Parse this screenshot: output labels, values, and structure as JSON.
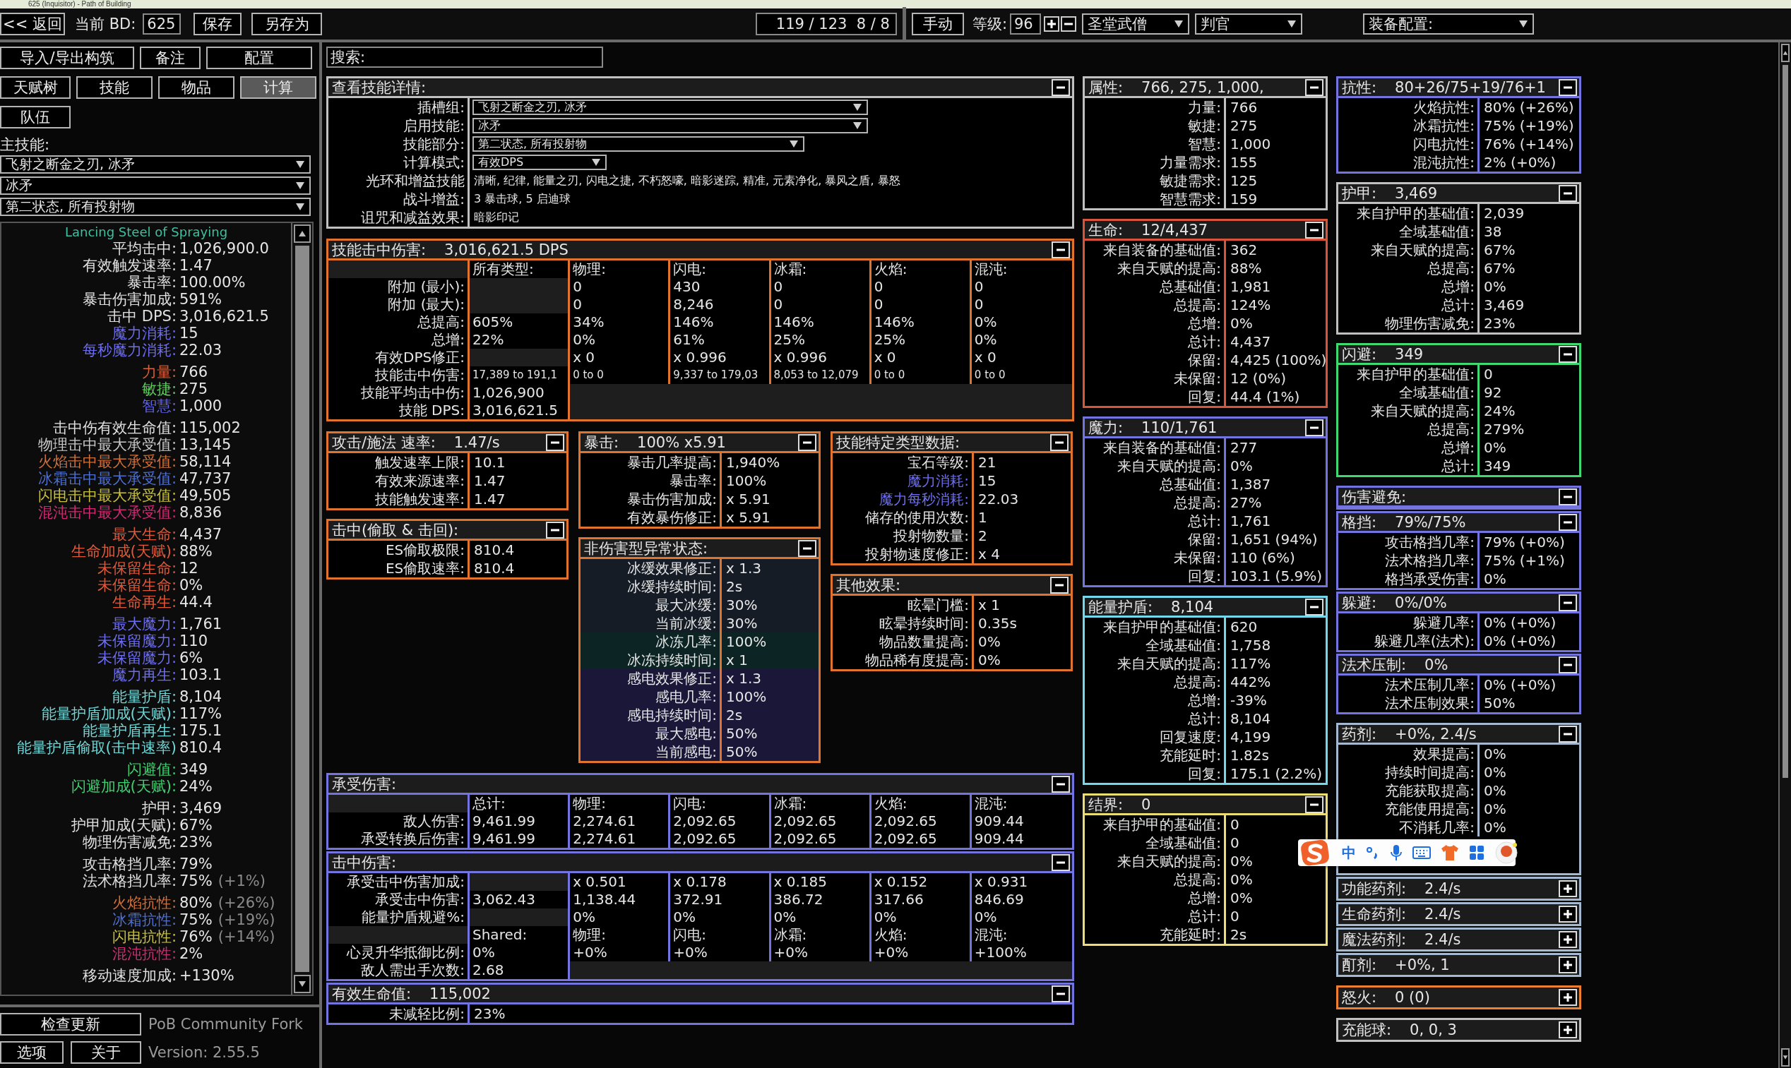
{
  "window": {
    "title": "625 (Inquisitor) - Path of Building"
  },
  "top_bar": {
    "back": "<< 返回",
    "build_label": "当前 BD:",
    "build_name": "625",
    "save": "保存",
    "save_as": "另存为",
    "points": "119 / 123  8 / 8",
    "mode": "手动",
    "level_label": "等级:",
    "level": "96",
    "class": "圣堂武僧",
    "ascendancy": "判官",
    "item_set": "装备配置:"
  },
  "left_panel": {
    "buttons": [
      {
        "label": "导入/导出构筑"
      },
      {
        "label": "备注"
      },
      {
        "label": "配置"
      }
    ],
    "tabs": [
      {
        "label": "天赋树",
        "selected": false
      },
      {
        "label": "技能",
        "selected": false
      },
      {
        "label": "物品",
        "selected": false
      },
      {
        "label": "计算",
        "selected": true
      },
      {
        "label": "队伍",
        "selected": false
      }
    ],
    "main_skill_label": "主技能:",
    "skill_selects": [
      "飞射之断金之刃, 冰矛",
      "冰矛",
      "第二状态, 所有投射物"
    ],
    "skill_name": "Lancing Steel of Spraying",
    "stat_groups": [
      [
        {
          "label": "平均击中:",
          "value": "1,026,900.0",
          "color": "#e0e0e0"
        },
        {
          "label": "有效触发速率:",
          "value": "1.47",
          "color": "#e0e0e0"
        },
        {
          "label": "暴击率:",
          "value": "100.00%",
          "color": "#e0e0e0"
        },
        {
          "label": "暴击伤害加成:",
          "value": "591%",
          "color": "#e0e0e0"
        },
        {
          "label": "击中 DPS:",
          "value": "3,016,621.5",
          "color": "#e0e0e0"
        },
        {
          "label": "魔力消耗:",
          "value": "15",
          "color": "#6e6ef0"
        },
        {
          "label": "每秒魔力消耗:",
          "value": "22.03",
          "color": "#6e6ef0"
        }
      ],
      [
        {
          "label": "力量:",
          "value": "766",
          "color": "#d8603a"
        },
        {
          "label": "敏捷:",
          "value": "275",
          "color": "#60d060"
        },
        {
          "label": "智慧:",
          "value": "1,000",
          "color": "#6262e8"
        }
      ],
      [
        {
          "label": "击中伤有效生命值:",
          "value": "115,002",
          "color": "#e0e0e0"
        },
        {
          "label": "物理击中最大承受值:",
          "value": "13,145",
          "color": "#c8c8c8"
        },
        {
          "label": "火焰击中最大承受值:",
          "value": "58,114",
          "color": "#d0703a"
        },
        {
          "label": "冰霜击中最大承受值:",
          "value": "47,737",
          "color": "#5070d0"
        },
        {
          "label": "闪电击中最大承受值:",
          "value": "49,505",
          "color": "#c8c040"
        },
        {
          "label": "混沌击中最大承受值:",
          "value": "8,836",
          "color": "#d02c74"
        }
      ],
      [
        {
          "label": "最大生命:",
          "value": "4,437",
          "color": "#e05a3a"
        },
        {
          "label": "生命加成(天赋):",
          "value": "88%",
          "color": "#e05a3a"
        },
        {
          "label": "未保留生命:",
          "value": "12",
          "color": "#e05a3a"
        },
        {
          "label": "未保留生命:",
          "value": "0%",
          "color": "#e05a3a"
        },
        {
          "label": "生命再生:",
          "value": "44.4",
          "color": "#e05a3a"
        }
      ],
      [
        {
          "label": "最大魔力:",
          "value": "1,761",
          "color": "#6e6ef0"
        },
        {
          "label": "未保留魔力:",
          "value": "110",
          "color": "#6e6ef0"
        },
        {
          "label": "未保留魔力:",
          "value": "6%",
          "color": "#6e6ef0"
        },
        {
          "label": "魔力再生:",
          "value": "103.1",
          "color": "#6e6ef0"
        }
      ],
      [
        {
          "label": "能量护盾:",
          "value": "8,104",
          "color": "#70d8d8"
        },
        {
          "label": "能量护盾加成(天赋):",
          "value": "117%",
          "color": "#70d8d8"
        },
        {
          "label": "能量护盾再生:",
          "value": "175.1",
          "color": "#70d8d8"
        },
        {
          "label": "能量护盾偷取(击中速率)",
          "value": "810.4",
          "color": "#70d8d8"
        }
      ],
      [
        {
          "label": "闪避值:",
          "value": "349",
          "color": "#40d070"
        },
        {
          "label": "闪避加成(天赋):",
          "value": "24%",
          "color": "#40d070"
        }
      ],
      [
        {
          "label": "护甲:",
          "value": "3,469",
          "color": "#e0e0e0"
        },
        {
          "label": "护甲加成(天赋):",
          "value": "67%",
          "color": "#e0e0e0"
        },
        {
          "label": "物理伤害减免:",
          "value": "23%",
          "color": "#e0e0e0"
        }
      ],
      [
        {
          "label": "攻击格挡几率:",
          "value": "79%",
          "color": "#e0e0e0"
        },
        {
          "label": "法术格挡几率:",
          "value": "75%",
          "extra": "(+1%)",
          "color": "#e0e0e0"
        }
      ],
      [
        {
          "label": "火焰抗性:",
          "value": "80%",
          "extra": "(+26%)",
          "color": "#d0703a"
        },
        {
          "label": "冰霜抗性:",
          "value": "75%",
          "extra": "(+19%)",
          "color": "#5070d0"
        },
        {
          "label": "闪电抗性:",
          "value": "76%",
          "extra": "(+14%)",
          "color": "#c8c040"
        },
        {
          "label": "混沌抗性:",
          "value": "2%",
          "color": "#d02c74"
        }
      ],
      [
        {
          "label": "移动速度加成:",
          "value": "+130%",
          "color": "#e0e0e0"
        }
      ]
    ],
    "footer": {
      "check_update": "检查更新",
      "fork": "PoB Community Fork",
      "options": "选项",
      "about": "关于",
      "version": "Version: 2.55.5"
    }
  },
  "search": {
    "label": "搜索:"
  },
  "column_a": {
    "top": [
      {
        "title": "查看技能详情:",
        "color": "#c0c0c0",
        "expanded": true,
        "kind": "fields",
        "rows": [
          {
            "label": "插槽组:",
            "value": "飞射之断金之刃, 冰矛",
            "kind": "select"
          },
          {
            "label": "启用技能:",
            "value": "冰矛",
            "kind": "select"
          },
          {
            "label": "技能部分:",
            "value": "第二状态, 所有投射物",
            "kind": "select"
          },
          {
            "label": "计算模式:",
            "value": "有效DPS",
            "kind": "select"
          },
          {
            "label": "光环和增益技能",
            "value": "清晰, 纪律, 能量之刃, 闪电之捷, 不朽怒嚎, 暗影迷踪, 精准, 元素净化, 暴风之盾, 暴怒",
            "kind": "text"
          },
          {
            "label": "战斗增益:",
            "value": "3 暴击球, 5 启迪球",
            "kind": "text"
          },
          {
            "label": "诅咒和减益效果:",
            "value": "暗影印记",
            "kind": "text"
          }
        ]
      },
      {
        "title": "技能击中伤害:",
        "value": "3,016,621.5 DPS",
        "color": "#e0742e",
        "expanded": true,
        "kind": "table",
        "columns": [
          "所有类型:",
          "物理:",
          "闪电:",
          "冰霜:",
          "火焰:",
          "混沌:"
        ],
        "rows": [
          {
            "label": "附加 (最小):",
            "cells": [
              null,
              "0",
              "430",
              "0",
              "0",
              "0"
            ]
          },
          {
            "label": "附加 (最大):",
            "cells": [
              null,
              "0",
              "8,246",
              "0",
              "0",
              "0"
            ]
          },
          {
            "label": "总提高:",
            "cells": [
              "605%",
              "34%",
              "146%",
              "146%",
              "146%",
              "0%"
            ]
          },
          {
            "label": "总增:",
            "cells": [
              "22%",
              "0%",
              "61%",
              "25%",
              "25%",
              "0%"
            ]
          },
          {
            "label": "有效DPS修正:",
            "cells": [
              null,
              "x 0",
              "x 0.996",
              "x 0.996",
              "x 0",
              "x 0"
            ]
          },
          {
            "label": "技能击中伤害:",
            "kind": "small",
            "cells": [
              "17,389 to 191,1",
              "0 to 0",
              "9,337 to 179,03",
              "8,053 to 12,079",
              "0 to 0",
              "0 to 0"
            ]
          },
          {
            "label": "技能平均击中伤:",
            "cells": [
              "1,026,900"
            ]
          },
          {
            "label": "技能 DPS:",
            "cells": [
              "3,016,621.5"
            ]
          }
        ]
      }
    ],
    "mini_columns": [
      [
        {
          "title": "攻击/施法 速率:",
          "value": "1.47/s",
          "color": "#e0742e",
          "expanded": true,
          "kind": "rows",
          "rows": [
            {
              "label": "触发速率上限:",
              "value": "10.1"
            },
            {
              "label": "有效来源速率:",
              "value": "1.47"
            },
            {
              "label": "技能触发速率:",
              "value": "1.47"
            }
          ]
        },
        {
          "title": "击中(偷取 & 击回):",
          "color": "#e0742e",
          "expanded": true,
          "kind": "rows",
          "rows": [
            {
              "label": "ES偷取极限:",
              "value": "810.4"
            },
            {
              "label": "ES偷取速率:",
              "value": "810.4"
            }
          ]
        }
      ],
      [
        {
          "title": "暴击:",
          "value": "100% x5.91",
          "color": "#e0742e",
          "expanded": true,
          "kind": "rows",
          "rows": [
            {
              "label": "暴击几率提高:",
              "value": "1,940%"
            },
            {
              "label": "暴击率:",
              "value": "100%"
            },
            {
              "label": "暴击伤害加成:",
              "value": "x 5.91"
            },
            {
              "label": "有效暴伤修正:",
              "value": "x 5.91"
            }
          ]
        },
        {
          "title": "非伤害型异常状态:",
          "color": "#e0742e",
          "expanded": true,
          "kind": "rows",
          "rows": [
            {
              "label": "冰缓效果修正:",
              "value": "x 1.3",
              "kind": "chill"
            },
            {
              "label": "冰缓持续时间:",
              "value": "2s",
              "kind": "chill"
            },
            {
              "label": "最大冰缓:",
              "value": "30%",
              "kind": "chill"
            },
            {
              "label": "当前冰缓:",
              "value": "30%",
              "kind": "chill"
            },
            {
              "label": "冰冻几率:",
              "value": "100%",
              "kind": "freeze"
            },
            {
              "label": "冰冻持续时间:",
              "value": "x 1",
              "kind": "freeze"
            },
            {
              "label": "感电效果修正:",
              "value": "x 1.3",
              "kind": "shock"
            },
            {
              "label": "感电几率:",
              "value": "100%",
              "kind": "shock"
            },
            {
              "label": "感电持续时间:",
              "value": "2s",
              "kind": "shock"
            },
            {
              "label": "最大感电:",
              "value": "50%",
              "kind": "shock"
            },
            {
              "label": "当前感电:",
              "value": "50%",
              "kind": "shock"
            }
          ]
        }
      ],
      [
        {
          "title": "技能特定类型数据:",
          "color": "#e0742e",
          "expanded": true,
          "kind": "rows",
          "rows": [
            {
              "label": "宝石等级:",
              "value": "21"
            },
            {
              "label": "魔力消耗:",
              "value": "15",
              "color": "#6e6ef0"
            },
            {
              "label": "魔力每秒消耗:",
              "value": "22.03",
              "color": "#6e6ef0"
            },
            {
              "label": "储存的使用次数:",
              "value": "1"
            },
            {
              "label": "投射物数量:",
              "value": "2"
            },
            {
              "label": "投射物速度修正:",
              "value": "x 4"
            }
          ]
        },
        {
          "title": "其他效果:",
          "color": "#e0742e",
          "expanded": true,
          "kind": "rows",
          "rows": [
            {
              "label": "眩晕门槛:",
              "value": "x 1"
            },
            {
              "label": "眩晕持续时间:",
              "value": "0.35s"
            },
            {
              "label": "物品数量提高:",
              "value": "0%"
            },
            {
              "label": "物品稀有度提高:",
              "value": "0%"
            }
          ]
        }
      ]
    ],
    "bottom": [
      {
        "title": "承受伤害:",
        "color": "#7474e0",
        "expanded": true,
        "kind": "table",
        "columns": [
          "总计:",
          "物理:",
          "闪电:",
          "冰霜:",
          "火焰:",
          "混沌:"
        ],
        "rows": [
          {
            "label": "敌人伤害:",
            "cells": [
              "9,461.99",
              "2,274.61",
              "2,092.65",
              "2,092.65",
              "2,092.65",
              "909.44"
            ]
          },
          {
            "label": "承受转换后伤害:",
            "cells": [
              "9,461.99",
              "2,274.61",
              "2,092.65",
              "2,092.65",
              "2,092.65",
              "909.44"
            ]
          }
        ]
      },
      {
        "title": "击中伤害:",
        "color": "#7474e0",
        "expanded": true,
        "kind": "table",
        "rows": [
          {
            "label": "承受击中伤害加成:",
            "cells": [
              null,
              "x 0.501",
              "x 0.178",
              "x 0.185",
              "x 0.152",
              "x 0.931"
            ]
          },
          {
            "label": "承受击中伤害:",
            "cells": [
              "3,062.43",
              "1,138.44",
              "372.91",
              "386.72",
              "317.66",
              "846.69"
            ]
          },
          {
            "label": "能量护盾规避%:",
            "cells": [
              null,
              "0%",
              "0%",
              "0%",
              "0%",
              "0%"
            ]
          },
          {
            "kind": "header",
            "cells": [
              "Shared:",
              "物理:",
              "闪电:",
              "冰霜:",
              "火焰:",
              "混沌:"
            ]
          },
          {
            "label": "心灵升华抵御比例:",
            "cells": [
              "0%",
              "+0%",
              "+0%",
              "+0%",
              "+0%",
              "+100%"
            ]
          },
          {
            "label": "敌人需出手次数:",
            "cells": [
              "2.68"
            ]
          }
        ]
      },
      {
        "title": "有效生命值:",
        "value": "115,002",
        "color": "#7474e0",
        "expanded": true,
        "kind": "rows",
        "rows": [
          {
            "label": "未减轻比例:",
            "value": "23%"
          }
        ]
      }
    ]
  },
  "column_b": [
    [
      {
        "title": "属性:",
        "value": "766, 275, 1,000,",
        "color": "#c0c0c0",
        "expanded": true,
        "kind": "rows",
        "rows": [
          {
            "label": "力量:",
            "value": "766"
          },
          {
            "label": "敏捷:",
            "value": "275"
          },
          {
            "label": "智慧:",
            "value": "1,000"
          },
          {
            "label": "力量需求:",
            "value": "155"
          },
          {
            "label": "敏捷需求:",
            "value": "125"
          },
          {
            "label": "智慧需求:",
            "value": "159"
          }
        ]
      }
    ],
    [
      {
        "title": "生命:",
        "value": "12/4,437",
        "color": "#d8553a",
        "expanded": true,
        "kind": "rows",
        "rows": [
          {
            "label": "来自装备的基础值:",
            "value": "362"
          },
          {
            "label": "来自天赋的提高:",
            "value": "88%"
          },
          {
            "label": "总基础值:",
            "value": "1,981"
          },
          {
            "label": "总提高:",
            "value": "124%"
          },
          {
            "label": "总增:",
            "value": "0%"
          },
          {
            "label": "总计:",
            "value": "4,437"
          },
          {
            "label": "保留:",
            "value": "4,425 (100%)"
          },
          {
            "label": "未保留:",
            "value": "12 (0%)"
          },
          {
            "label": "回复:",
            "value": "44.4 (1%)"
          }
        ]
      }
    ],
    [
      {
        "title": "魔力:",
        "value": "110/1,761",
        "color": "#7474e0",
        "expanded": true,
        "kind": "rows",
        "rows": [
          {
            "label": "来自装备的基础值:",
            "value": "277"
          },
          {
            "label": "来自天赋的提高:",
            "value": "0%"
          },
          {
            "label": "总基础值:",
            "value": "1,387"
          },
          {
            "label": "总提高:",
            "value": "27%"
          },
          {
            "label": "总计:",
            "value": "1,761"
          },
          {
            "label": "保留:",
            "value": "1,651 (94%)"
          },
          {
            "label": "未保留:",
            "value": "110 (6%)"
          },
          {
            "label": "回复:",
            "value": "103.1 (5.9%)"
          }
        ]
      }
    ],
    [
      {
        "title": "能量护盾:",
        "value": "8,104",
        "color": "#74d8ec",
        "expanded": true,
        "kind": "rows",
        "rows": [
          {
            "label": "来自护甲的基础值:",
            "value": "620"
          },
          {
            "label": "全域基础值:",
            "value": "1,758"
          },
          {
            "label": "来自天赋的提高:",
            "value": "117%"
          },
          {
            "label": "总提高:",
            "value": "442%"
          },
          {
            "label": "总增:",
            "value": "-39%"
          },
          {
            "label": "总计:",
            "value": "8,104"
          },
          {
            "label": "回复速度:",
            "value": "4,199"
          },
          {
            "label": "充能延时:",
            "value": "1.82s"
          },
          {
            "label": "回复:",
            "value": "175.1 (2.2%)"
          }
        ]
      }
    ],
    [
      {
        "title": "结界:",
        "value": "0",
        "color": "#ecdc74",
        "expanded": true,
        "kind": "rows",
        "rows": [
          {
            "label": "来自护甲的基础值:",
            "value": "0"
          },
          {
            "label": "全域基础值:",
            "value": "0"
          },
          {
            "label": "来自天赋的提高:",
            "value": "0%"
          },
          {
            "label": "总提高:",
            "value": "0%"
          },
          {
            "label": "总增:",
            "value": "0%"
          },
          {
            "label": "总计:",
            "value": "0"
          },
          {
            "label": "充能延时:",
            "value": "2s"
          }
        ]
      }
    ]
  ],
  "column_c": [
    [
      {
        "title": "抗性:",
        "value": "80+26/75+19/76+1",
        "color": "#7474e0",
        "expanded": true,
        "kind": "rows",
        "rows": [
          {
            "label": "火焰抗性:",
            "value": "80% (+26%)"
          },
          {
            "label": "冰霜抗性:",
            "value": "75% (+19%)"
          },
          {
            "label": "闪电抗性:",
            "value": "76% (+14%)"
          },
          {
            "label": "混沌抗性:",
            "value": "2% (+0%)"
          }
        ]
      }
    ],
    [
      {
        "title": "护甲:",
        "value": "3,469",
        "color": "#c0c0c0",
        "expanded": true,
        "kind": "rows",
        "rows": [
          {
            "label": "来自护甲的基础值:",
            "value": "2,039"
          },
          {
            "label": "全域基础值:",
            "value": "38"
          },
          {
            "label": "来自天赋的提高:",
            "value": "67%"
          },
          {
            "label": "总提高:",
            "value": "67%"
          },
          {
            "label": "总增:",
            "value": "0%"
          },
          {
            "label": "总计:",
            "value": "3,469"
          },
          {
            "label": "物理伤害减免:",
            "value": "23%"
          }
        ]
      }
    ],
    [
      {
        "title": "闪避:",
        "value": "349",
        "color": "#40d870",
        "expanded": true,
        "kind": "rows",
        "rows": [
          {
            "label": "来自护甲的基础值:",
            "value": "0"
          },
          {
            "label": "全域基础值:",
            "value": "92"
          },
          {
            "label": "来自天赋的提高:",
            "value": "24%"
          },
          {
            "label": "总提高:",
            "value": "279%"
          },
          {
            "label": "总增:",
            "value": "0%"
          },
          {
            "label": "总计:",
            "value": "349"
          }
        ]
      }
    ],
    [
      {
        "title": "伤害避免:",
        "color": "#7474e0",
        "expanded": true,
        "kind": "rows"
      },
      {
        "title": "格挡:",
        "value": "79%/75%",
        "color": "#7474e0",
        "expanded": true,
        "kind": "rows",
        "rows": [
          {
            "label": "攻击格挡几率:",
            "value": "79% (+0%)"
          },
          {
            "label": "法术格挡几率:",
            "value": "75% (+1%)"
          },
          {
            "label": "格挡承受伤害:",
            "value": "0%"
          }
        ]
      },
      {
        "title": "躲避:",
        "value": "0%/0%",
        "color": "#7474e0",
        "expanded": true,
        "kind": "rows",
        "rows": [
          {
            "label": "躲避几率:",
            "value": "0% (+0%)"
          },
          {
            "label": "躲避几率(法术):",
            "value": "0% (+0%)"
          }
        ]
      },
      {
        "title": "法术压制:",
        "value": "0%",
        "color": "#7474e0",
        "expanded": true,
        "kind": "rows",
        "rows": [
          {
            "label": "法术压制几率:",
            "value": "0% (+0%)"
          },
          {
            "label": "法术压制效果:",
            "value": "50%"
          }
        ]
      }
    ],
    [
      {
        "title": "药剂:",
        "value": "+0%, 2.4/s",
        "color": "#a4b8d0",
        "expanded": true,
        "kind": "rows",
        "covered": true,
        "rows": [
          {
            "label": "效果提高:",
            "value": "0%"
          },
          {
            "label": "持续时间提高:",
            "value": "0%"
          },
          {
            "label": "充能获取提高:",
            "value": "0%"
          },
          {
            "label": "充能使用提高:",
            "value": "0%"
          },
          {
            "label": "不消耗几率:",
            "value": "0%"
          }
        ]
      },
      {
        "title": "功能药剂:",
        "value": "2.4/s",
        "color": "#a4b8d0",
        "expanded": false
      },
      {
        "title": "生命药剂:",
        "value": "2.4/s",
        "color": "#a4b8d0",
        "expanded": false
      },
      {
        "title": "魔法药剂:",
        "value": "2.4/s",
        "color": "#a4b8d0",
        "expanded": false
      },
      {
        "title": "酊剂:",
        "value": "+0%, 1",
        "color": "#a4b8d0",
        "expanded": false
      }
    ],
    [
      {
        "title": "怒火:",
        "value": "0 (0)",
        "color": "#ec8030",
        "expanded": false
      }
    ],
    [
      {
        "title": "充能球:",
        "value": "0, 0, 3",
        "color": "#c0c0c0",
        "expanded": false
      }
    ]
  ],
  "ime_toolbar": {
    "mode": "中"
  }
}
